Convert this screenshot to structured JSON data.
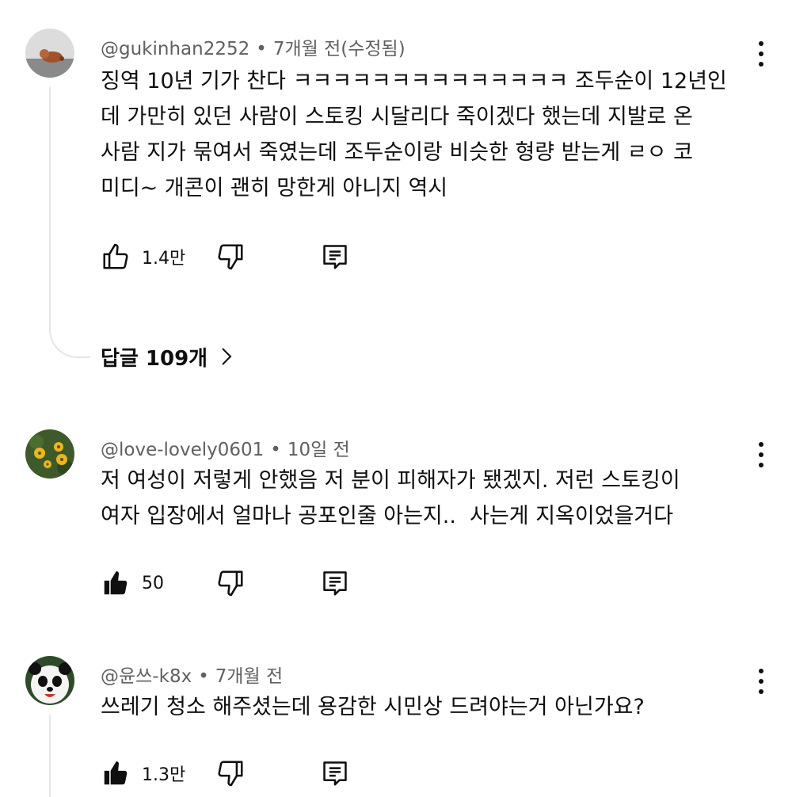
{
  "comments": [
    {
      "author": "@gukinhan2252",
      "time": "7개월 전(수정됨)",
      "text": "징역 10년 기가 찬다 ㅋㅋㅋㅋㅋㅋㅋㅋㅋㅋㅋㅋㅋㅋ 조두순이 12년인\n데 가만히 있던 사람이 스토킹 시달리다 죽이겠다 했는데 지발로 온\n사람 지가 묶여서 죽였는데 조두순이랑 비슷한 형량 받는게 ㄹㅇ 코\n미디~ 개콘이 괜히 망한게 아니지 역시",
      "likes": "1.4만",
      "liked": false,
      "replies_label": "답글 109개"
    },
    {
      "author": "@love-lovely0601",
      "time": "10일 전",
      "text": "저 여성이 저렇게 안했음 저 분이 피해자가 됐겠지. 저런 스토킹이\n여자 입장에서 얼마나 공포인줄 아는지..  사는게 지옥이었을거다",
      "likes": "50",
      "liked": true
    },
    {
      "author": "@윤쓰-k8x",
      "time": "7개월 전",
      "text": "쓰레기 청소 해주셨는데 용감한 시민상 드려야는거 아닌가요?",
      "likes": "1.3만",
      "liked": true
    }
  ],
  "separator": "•",
  "icons": {
    "like": "thumbs-up-icon",
    "dislike": "thumbs-down-icon",
    "reply": "comment-reply-icon",
    "menu": "more-vert-icon",
    "chevron": "chevron-right-icon"
  },
  "colors": {
    "text": "#0f0f0f",
    "meta": "#606060",
    "thread": "#e5e5e5"
  }
}
